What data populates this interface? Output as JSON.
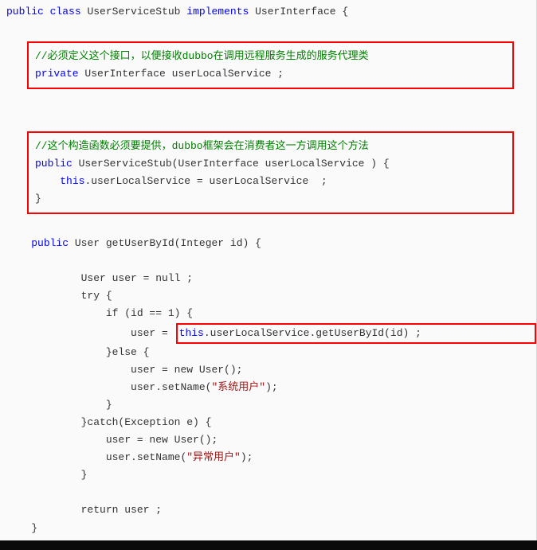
{
  "code": {
    "decl_public": "public",
    "decl_class": "class",
    "decl_name": "UserServiceStub",
    "decl_implements": "implements",
    "decl_iface": "UserInterface",
    "decl_brace": " {",
    "box1": {
      "comment": "//必须定义这个接口，以便接收dubbo在调用远程服务生成的服务代理类",
      "private": "private",
      "type": "UserInterface",
      "field": "userLocalService ;"
    },
    "box2": {
      "comment": "//这个构造函数必须要提供，dubbo框架会在消费者这一方调用这个方法",
      "public": "public",
      "ctor": "UserServiceStub(UserInterface userLocalService ) {",
      "this": "this",
      "assign": ".userLocalService = userLocalService  ;",
      "close": "}"
    },
    "method": {
      "public": "public",
      "rettype": "User",
      "sig": "getUserById(Integer id) {",
      "l1": "User user = null ;",
      "l2": "try {",
      "l3a": "if (id == ",
      "l3b": "1) {",
      "l4a": "user = ",
      "l4b_this": "this",
      "l4b_rest": ".userLocalService.getUserById(id) ;",
      "l5": "}else {",
      "l6": "user = new User();",
      "l7a": "user.setName(",
      "l7s": "\"系统用户\"",
      "l7b": ");",
      "l8": "}",
      "l9": "}catch(Exception e) {",
      "l10": "user = new User();",
      "l11a": "user.setName(",
      "l11s": "\"异常用户\"",
      "l11b": ");",
      "l12": "}",
      "ret": "return user ;",
      "close": "}"
    }
  }
}
